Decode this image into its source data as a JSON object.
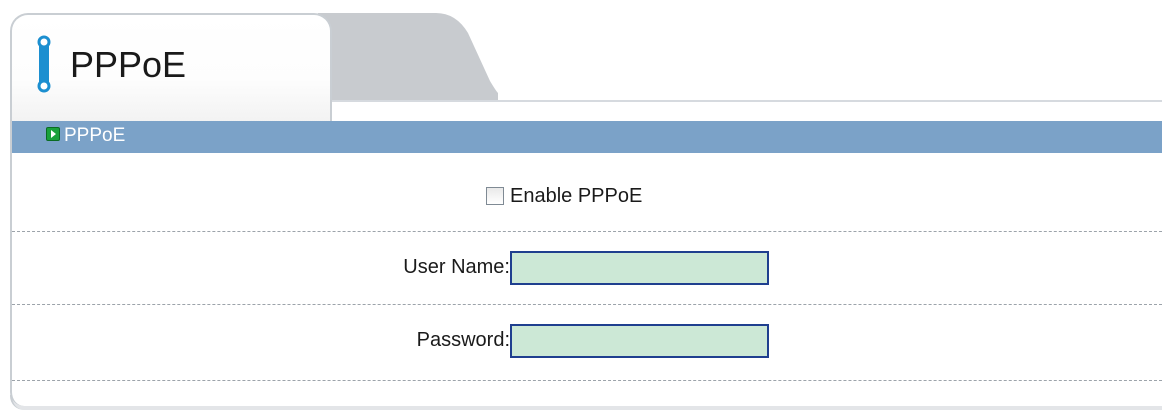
{
  "tabs": [
    {
      "label": "PPPoE",
      "active": true
    },
    {
      "label": "",
      "active": false
    }
  ],
  "section": {
    "title": "PPPoE",
    "icon": "green-arrow-icon"
  },
  "form": {
    "enable_label": "Enable PPPoE",
    "enable_checked": false,
    "username_label": "User Name:",
    "username_value": "",
    "password_label": "Password:",
    "password_value": ""
  },
  "colors": {
    "section_bar": "#7ba2c8",
    "input_bg": "#cce8d6",
    "input_border": "#1f3f8f",
    "tab_icon": "#1c8fd0"
  }
}
